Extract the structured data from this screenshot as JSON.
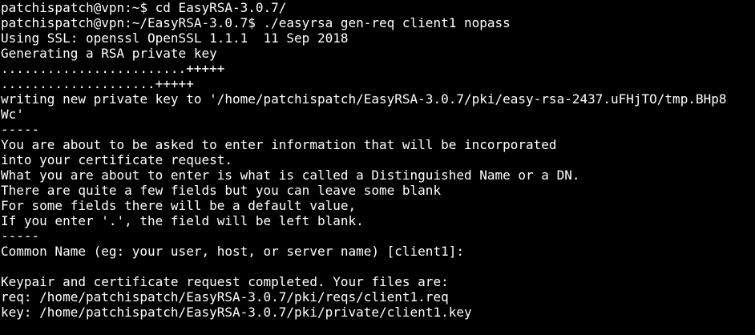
{
  "terminal": {
    "lines": [
      "patchispatch@vpn:~$ cd EasyRSA-3.0.7/",
      "patchispatch@vpn:~/EasyRSA-3.0.7$ ./easyrsa gen-req client1 nopass",
      "Using SSL: openssl OpenSSL 1.1.1  11 Sep 2018",
      "Generating a RSA private key",
      "........................+++++",
      "....................+++++",
      "writing new private key to '/home/patchispatch/EasyRSA-3.0.7/pki/easy-rsa-2437.uFHjTO/tmp.BHp8",
      "Wc'",
      "-----",
      "You are about to be asked to enter information that will be incorporated",
      "into your certificate request.",
      "What you are about to enter is what is called a Distinguished Name or a DN.",
      "There are quite a few fields but you can leave some blank",
      "For some fields there will be a default value,",
      "If you enter '.', the field will be left blank.",
      "-----",
      "Common Name (eg: your user, host, or server name) [client1]:",
      "",
      "Keypair and certificate request completed. Your files are:",
      "req: /home/patchispatch/EasyRSA-3.0.7/pki/reqs/client1.req",
      "key: /home/patchispatch/EasyRSA-3.0.7/pki/private/client1.key"
    ]
  }
}
